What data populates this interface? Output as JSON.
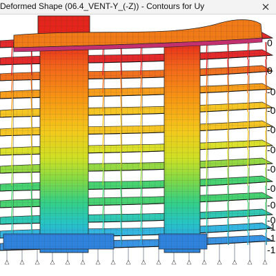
{
  "window": {
    "title": "Deformed Shape (06.4_VENT-Y_(-Z)) - Contours for Uy",
    "close_icon": "close-icon"
  },
  "contour_scale": {
    "labels": [
      "0",
      "0",
      "-0",
      "-0",
      "-0",
      "-0",
      "-0",
      "-0",
      "-0",
      "-0",
      "-1",
      "-1",
      "-1"
    ],
    "colors": [
      "#e32020",
      "#f06a14",
      "#f79a10",
      "#f5c21a",
      "#d9df20",
      "#8fd63a",
      "#3fd06a",
      "#26c6b0",
      "#2bb3e0",
      "#2f8fe3"
    ]
  }
}
